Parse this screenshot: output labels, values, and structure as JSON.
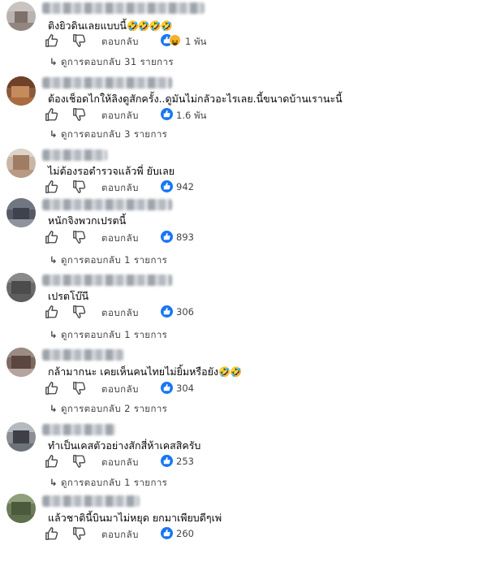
{
  "comments": [
    {
      "text": "ติงยิวดินเลยแบบนี้",
      "emoji": "🤣🤣🤣🤣",
      "reply_label": "ตอบกลับ",
      "reaction_count": "1 พัน",
      "reaction_type": "like-haha",
      "view_replies": "ดูการตอบกลับ 31 รายการ"
    },
    {
      "text": "ต้องเช็อดไกให้ลิงดูสักครั้ง..ดูมันไม่กลัวอะไรเลย.นี้ขนาดบ้านเรานะนี้",
      "emoji": "",
      "reply_label": "ตอบกลับ",
      "reaction_count": "1.6 พัน",
      "reaction_type": "like",
      "view_replies": "ดูการตอบกลับ 3 รายการ"
    },
    {
      "text": "ไม่ต้องรอตำรวจแล้วพี่ ยับเลย",
      "emoji": "",
      "reply_label": "ตอบกลับ",
      "reaction_count": "942",
      "reaction_type": "like",
      "view_replies": ""
    },
    {
      "text": "หนักจิงพวกเปรตนี้",
      "emoji": "",
      "reply_label": "ตอบกลับ",
      "reaction_count": "893",
      "reaction_type": "like",
      "view_replies": "ดูการตอบกลับ 1 รายการ"
    },
    {
      "text": "เปรตโบ๊นี",
      "emoji": "",
      "reply_label": "ตอบกลับ",
      "reaction_count": "306",
      "reaction_type": "like",
      "view_replies": "ดูการตอบกลับ 1 รายการ"
    },
    {
      "text": "กล้ามากนะ เคยเห็นคนไทยไม่ยิ้มหรือยัง",
      "emoji": "🤣🤣",
      "reply_label": "ตอบกลับ",
      "reaction_count": "304",
      "reaction_type": "like",
      "view_replies": "ดูการตอบกลับ 2 รายการ"
    },
    {
      "text": "ทำเป็นเคสตัวอย่างสักสี่ห้าเคสสิครับ",
      "emoji": "",
      "reply_label": "ตอบกลับ",
      "reaction_count": "253",
      "reaction_type": "like",
      "view_replies": "ดูการตอบกลับ 1 รายการ"
    },
    {
      "text": "แล้วชาตินี้บินมาไม่หยุด ยกมาเพียบดีๆเพ่",
      "emoji": "",
      "reply_label": "ตอบกลับ",
      "reaction_count": "260",
      "reaction_type": "like",
      "view_replies": ""
    }
  ],
  "colors": {
    "like_blue": "#1877f2",
    "text": "#050505",
    "muted": "#444444"
  },
  "icons": [
    "thumbs-up-icon",
    "thumbs-down-icon",
    "like-reaction-icon",
    "haha-reaction-icon",
    "reply-arrow-icon"
  ]
}
